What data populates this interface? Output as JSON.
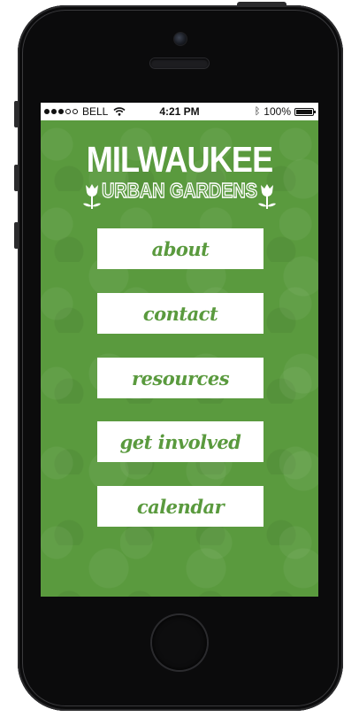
{
  "status_bar": {
    "carrier": "BELL",
    "time": "4:21 PM",
    "battery_text": "100%",
    "battery_level": 1.0,
    "icons": [
      "signal-dots-icon",
      "wifi-icon",
      "bluetooth-icon",
      "battery-icon"
    ]
  },
  "logo": {
    "title": "MILWAUKEE",
    "subtitle": "URBAN GARDENS",
    "icons": [
      "tulip-icon",
      "tulip-icon"
    ]
  },
  "menu": {
    "items": [
      {
        "label": "about"
      },
      {
        "label": "contact"
      },
      {
        "label": "resources"
      },
      {
        "label": "get involved"
      },
      {
        "label": "calendar"
      }
    ]
  },
  "colors": {
    "background_green": "#5a9a3e",
    "button_bg": "#ffffff",
    "button_text": "#5a9a3e",
    "device_body": "#0b0b0c"
  }
}
